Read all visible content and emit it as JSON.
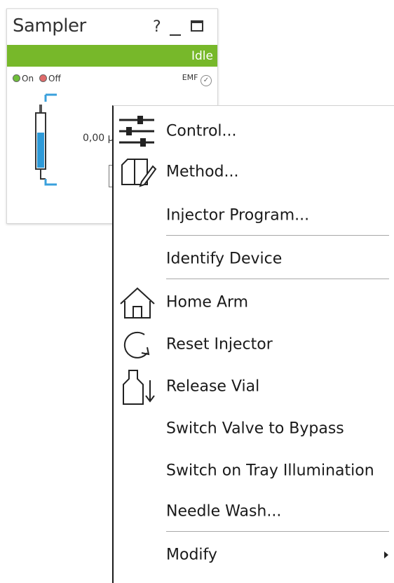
{
  "panel": {
    "title": "Sampler",
    "help_label": "?",
    "status": "Idle",
    "status_color": "#77b82a",
    "on_label": "On",
    "off_label": "Off",
    "emf_label": "EMF",
    "emf_check": "✓",
    "reading": "0,00 μ"
  },
  "menu": {
    "items": [
      {
        "label": "Control...",
        "icon": "sliders-icon"
      },
      {
        "label": "Method...",
        "icon": "method-icon"
      },
      {
        "label": "Injector Program...",
        "icon": ""
      },
      {
        "label": "Identify Device",
        "icon": ""
      },
      {
        "label": "Home Arm",
        "icon": "home-icon"
      },
      {
        "label": "Reset Injector",
        "icon": "reset-icon"
      },
      {
        "label": "Release Vial",
        "icon": "release-vial-icon"
      },
      {
        "label": "Switch Valve to Bypass",
        "icon": ""
      },
      {
        "label": "Switch on Tray Illumination",
        "icon": ""
      },
      {
        "label": "Needle Wash...",
        "icon": ""
      },
      {
        "label": "Modify",
        "icon": "",
        "submenu": true
      }
    ]
  }
}
